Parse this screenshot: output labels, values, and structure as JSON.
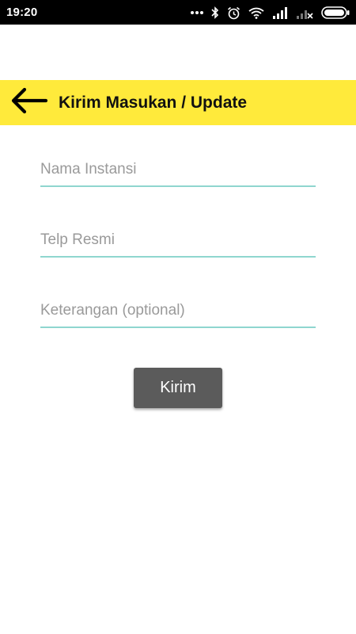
{
  "status_bar": {
    "time": "19:20",
    "icons": [
      "dots-icon",
      "bluetooth-icon",
      "alarm-icon",
      "wifi-icon",
      "signal-icon",
      "signal-no-sim-icon",
      "battery-icon"
    ]
  },
  "toolbar": {
    "title": "Kirim Masukan / Update",
    "back_icon": "arrow-left-icon",
    "background": "#ffea3b"
  },
  "form": {
    "nama_instansi": {
      "placeholder": "Nama Instansi",
      "value": ""
    },
    "telp_resmi": {
      "placeholder": "Telp Resmi",
      "value": ""
    },
    "keterangan": {
      "placeholder": "Keterangan (optional)",
      "value": ""
    },
    "submit_label": "Kirim",
    "underline_color": "#8fd6cf",
    "button_color": "#5b5b5b"
  }
}
